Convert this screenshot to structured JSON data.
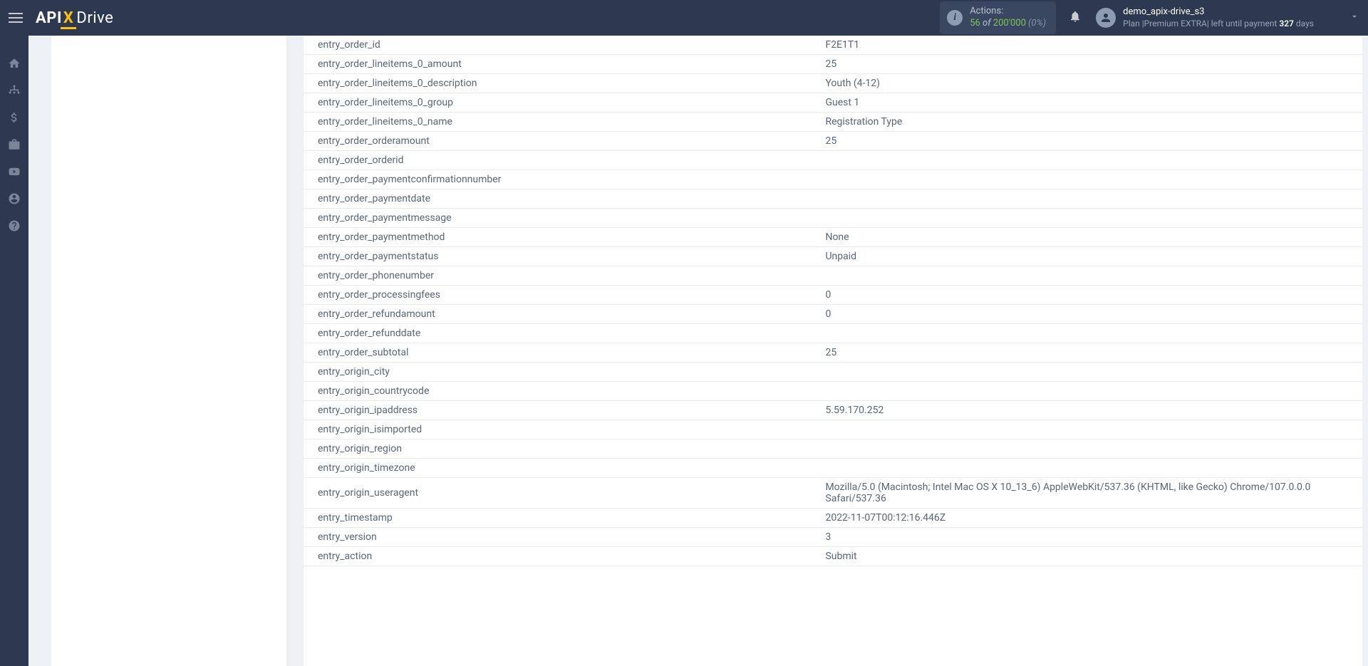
{
  "header": {
    "logo_api": "API",
    "logo_x": "X",
    "logo_drive": "Drive",
    "actions_label": "Actions:",
    "actions_num": "56",
    "actions_of": " of ",
    "actions_total": "200'000",
    "actions_pct": " (0%)",
    "user_name": "demo_apix-drive_s3",
    "plan_prefix": "Plan |Premium EXTRA| left until payment ",
    "plan_days": "327",
    "plan_suffix": " days"
  },
  "rows": [
    {
      "key": "entry_order_id",
      "val": "F2E1T1"
    },
    {
      "key": "entry_order_lineitems_0_amount",
      "val": "25"
    },
    {
      "key": "entry_order_lineitems_0_description",
      "val": "Youth (4-12)"
    },
    {
      "key": "entry_order_lineitems_0_group",
      "val": "Guest 1"
    },
    {
      "key": "entry_order_lineitems_0_name",
      "val": "Registration Type"
    },
    {
      "key": "entry_order_orderamount",
      "val": "25"
    },
    {
      "key": "entry_order_orderid",
      "val": ""
    },
    {
      "key": "entry_order_paymentconfirmationnumber",
      "val": ""
    },
    {
      "key": "entry_order_paymentdate",
      "val": ""
    },
    {
      "key": "entry_order_paymentmessage",
      "val": ""
    },
    {
      "key": "entry_order_paymentmethod",
      "val": "None"
    },
    {
      "key": "entry_order_paymentstatus",
      "val": "Unpaid"
    },
    {
      "key": "entry_order_phonenumber",
      "val": ""
    },
    {
      "key": "entry_order_processingfees",
      "val": "0"
    },
    {
      "key": "entry_order_refundamount",
      "val": "0"
    },
    {
      "key": "entry_order_refunddate",
      "val": ""
    },
    {
      "key": "entry_order_subtotal",
      "val": "25"
    },
    {
      "key": "entry_origin_city",
      "val": ""
    },
    {
      "key": "entry_origin_countrycode",
      "val": ""
    },
    {
      "key": "entry_origin_ipaddress",
      "val": "5.59.170.252"
    },
    {
      "key": "entry_origin_isimported",
      "val": ""
    },
    {
      "key": "entry_origin_region",
      "val": ""
    },
    {
      "key": "entry_origin_timezone",
      "val": ""
    },
    {
      "key": "entry_origin_useragent",
      "val": "Mozilla/5.0 (Macintosh; Intel Mac OS X 10_13_6) AppleWebKit/537.36 (KHTML, like Gecko) Chrome/107.0.0.0 Safari/537.36"
    },
    {
      "key": "entry_timestamp",
      "val": "2022-11-07T00:12:16.446Z"
    },
    {
      "key": "entry_version",
      "val": "3"
    },
    {
      "key": "entry_action",
      "val": "Submit"
    }
  ]
}
